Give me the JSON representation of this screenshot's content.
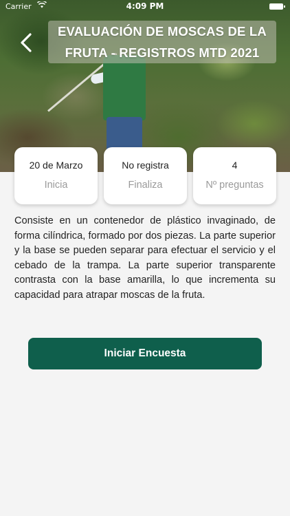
{
  "status_bar": {
    "carrier": "Carrier",
    "time": "4:09 PM"
  },
  "header": {
    "title_line1": "EVALUACIÓN DE MOSCAS DE LA",
    "title_line2": "FRUTA - REGISTROS MTD 2021",
    "back_icon": "chevron-left-icon"
  },
  "cards": [
    {
      "value": "20 de Marzo",
      "label": "Inicia"
    },
    {
      "value": "No registra",
      "label": "Finaliza"
    },
    {
      "value": "4",
      "label": "Nº preguntas"
    }
  ],
  "description": "Consiste en un contenedor de plástico invaginado, de forma cilíndrica, formado por dos piezas. La parte superior y la base se pueden separar para efectuar el servicio y el cebado de la trampa. La parte superior transparente contrasta con la base amarilla, lo que incrementa su capacidad para atrapar moscas de la fruta.",
  "actions": {
    "start_label": "Iniciar Encuesta"
  },
  "colors": {
    "primary": "#0f5f4c",
    "background": "#f4f4f4"
  }
}
